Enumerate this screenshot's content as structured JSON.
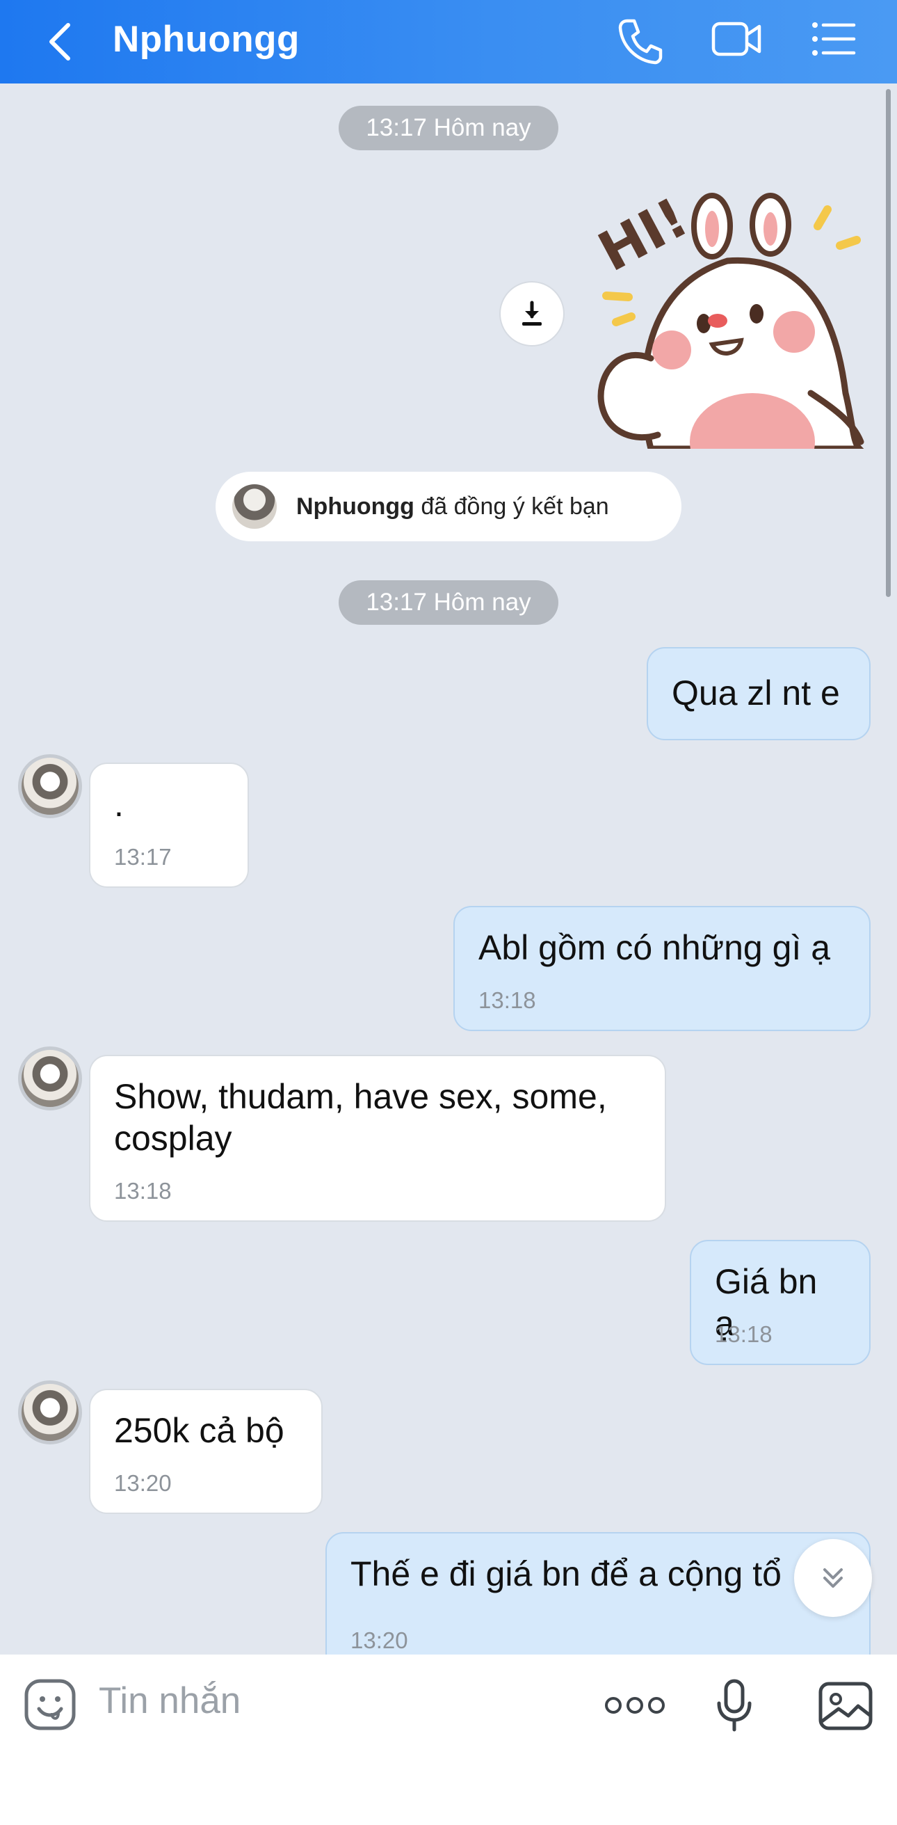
{
  "header": {
    "title": "Nphuongg"
  },
  "chat": {
    "time_pill_1": "13:17 Hôm nay",
    "time_pill_2": "13:17 Hôm nay",
    "friend_notice": {
      "name": "Nphuongg",
      "text": " đã đồng ý kết bạn"
    },
    "messages": [
      {
        "dir": "out",
        "text": "Qua zl nt e",
        "time": ""
      },
      {
        "dir": "in",
        "text": ".",
        "time": "13:17"
      },
      {
        "dir": "out",
        "text": "Abl gồm có những gì ạ",
        "time": "13:18"
      },
      {
        "dir": "in",
        "text": "Show, thudam, have sex, some, cosplay",
        "time": "13:18"
      },
      {
        "dir": "out",
        "text": "Giá bn ạ",
        "time": "13:18"
      },
      {
        "dir": "in",
        "text": "250k cả bộ",
        "time": "13:20"
      },
      {
        "dir": "out",
        "text": "Thế e đi giá bn để a cộng tổ",
        "time": "13:20"
      }
    ]
  },
  "sticker": {
    "text": "HI!"
  },
  "composer": {
    "placeholder": "Tin nhắn"
  },
  "colors": {
    "header": "#2f86f1",
    "out_bubble": "#d6e9fb",
    "in_bubble": "#ffffff",
    "background": "#e2e7ef"
  }
}
